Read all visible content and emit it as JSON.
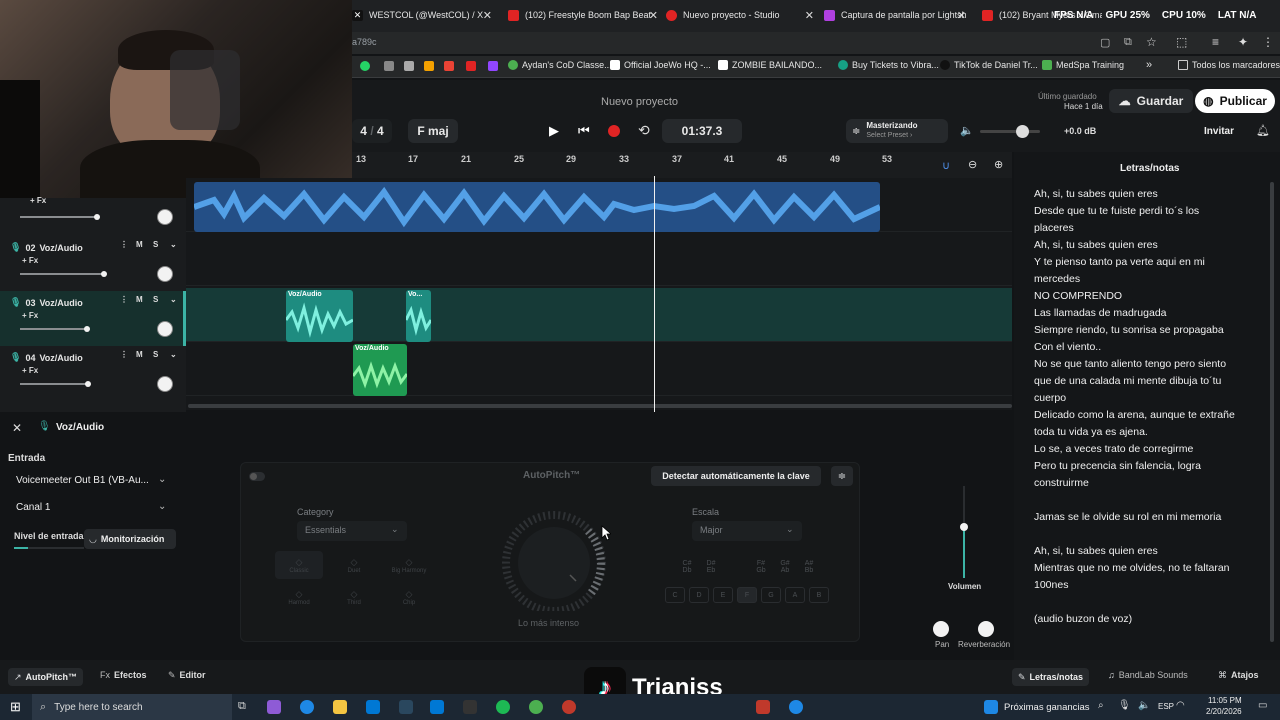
{
  "browser": {
    "tabs": [
      {
        "title": "WESTCOL (@WestCOL) / X",
        "color": "#cccccc"
      },
      {
        "title": "(102) Freestyle Boom Bap Beat",
        "color": "#e02424"
      },
      {
        "title": "Nuevo proyecto - Studio",
        "color": "#e02424"
      },
      {
        "title": "Captura de pantalla por Lightsh",
        "color": "#b040e0"
      },
      {
        "title": "(102) Bryant Myers x Omar Co",
        "color": "#e02424"
      }
    ],
    "url": "a789c",
    "bookmarks": [
      "Aydan's CoD Classe...",
      "Official JoeWo HQ -...",
      "ZOMBIE BAILANDO...",
      "Buy Tickets to Vibra...",
      "TikTok de Daniel Tr...",
      "MedSpa Training",
      "Todos los marcadores"
    ]
  },
  "stats_overlay": {
    "fps": "FPS N/A",
    "gpu": "GPU 25%",
    "cpu": "CPU 10%",
    "lat": "LAT N/A"
  },
  "header": {
    "project_title": "Nuevo proyecto",
    "last_saved_label": "Último guardado",
    "last_saved_value": "Hace 1 día",
    "save_label": "Guardar",
    "publish_label": "Publicar",
    "invite_label": "Invitar",
    "time_sig_num": "4",
    "time_sig_sep": "/",
    "time_sig_den": "4",
    "key": "F maj",
    "time": "01:37.3",
    "mastering_label": "Masterizando",
    "mastering_preset": "Select Preset ›",
    "master_volume": "+0.0 dB"
  },
  "ruler": [
    "13",
    "17",
    "21",
    "25",
    "29",
    "33",
    "37",
    "41",
    "45",
    "49",
    "53"
  ],
  "tracks": [
    {
      "num": "",
      "name": "",
      "fx": "+ Fx"
    },
    {
      "num": "02",
      "name": "Voz/Audio",
      "fx": "+ Fx",
      "m": "M",
      "s": "S"
    },
    {
      "num": "03",
      "name": "Voz/Audio",
      "fx": "+ Fx",
      "m": "M",
      "s": "S"
    },
    {
      "num": "04",
      "name": "Voz/Audio",
      "fx": "+ Fx",
      "m": "M",
      "s": "S"
    }
  ],
  "clips": {
    "a": "Voz/Audio",
    "b": "Vo...",
    "c": "Voz/Audio"
  },
  "lyrics": {
    "title": "Letras/notas",
    "lines": [
      "Ah, si, tu sabes quien eres",
      "Desde que tu te fuiste perdi to´s los",
      "placeres",
      "Ah, si, tu sabes quien eres",
      "Y te pienso tanto pa verte aqui en mi",
      "mercedes",
      "NO COMPRENDO",
      "Las llamadas de madrugada",
      "Siempre riendo, tu sonrisa se propagaba",
      "Con el viento..",
      "No se que tanto aliento tengo pero siento",
      "que de una calada mi mente dibuja to´tu",
      "cuerpo",
      "Delicado como la arena, aunque te extrañe",
      "toda tu vida ya es ajena.",
      "Lo se, a veces trato de corregirme",
      "Pero tu precencia sin falencia, logra",
      "construirme",
      "",
      "Jamas se le olvide su rol en mi memoria",
      "",
      "Ah, si, tu sabes quien eres",
      "Mientras que no me olvides, no te faltaran",
      "100nes",
      "",
      "(audio buzon de voz)"
    ]
  },
  "panel": {
    "track_label": "Voz/Audio",
    "input_label": "Entrada",
    "input_device": "Voicemeeter Out B1 (VB-Au...",
    "channel": "Canal 1",
    "input_level_label": "Nivel de entrada",
    "monitor_label": "Monitorización",
    "autopitch_title": "AutoPitch™",
    "detect_key_label": "Detectar automáticamente la clave",
    "category_label": "Category",
    "category_value": "Essentials",
    "effects": [
      "Classic",
      "Duet",
      "Big Harmony",
      "Harmod",
      "Third",
      "Chip"
    ],
    "intensity_label": "Lo más intenso",
    "scale_label": "Escala",
    "scale_value": "Major",
    "scale_keys": [
      "C#\nDb",
      "D#\nEb",
      "F#\nGb",
      "G#\nAb",
      "A#\nBb"
    ],
    "natural_keys": [
      "C",
      "D",
      "E",
      "F",
      "G",
      "A",
      "B"
    ],
    "volume_label": "Volumen",
    "pan_label": "Pan",
    "reverb_label": "Reverberación"
  },
  "footer": {
    "autopitch": "AutoPitch™",
    "effects": "Efectos",
    "editor": "Editor",
    "lyrics": "Letras/notas",
    "sounds": "BandLab Sounds",
    "shortcuts": "Atajos"
  },
  "watermark": "Trianiss",
  "taskbar": {
    "search_placeholder": "Type here to search",
    "weather": "Próximas ganancias",
    "lang": "ESP",
    "time": "11:05 PM",
    "date": "2/20/2026"
  }
}
